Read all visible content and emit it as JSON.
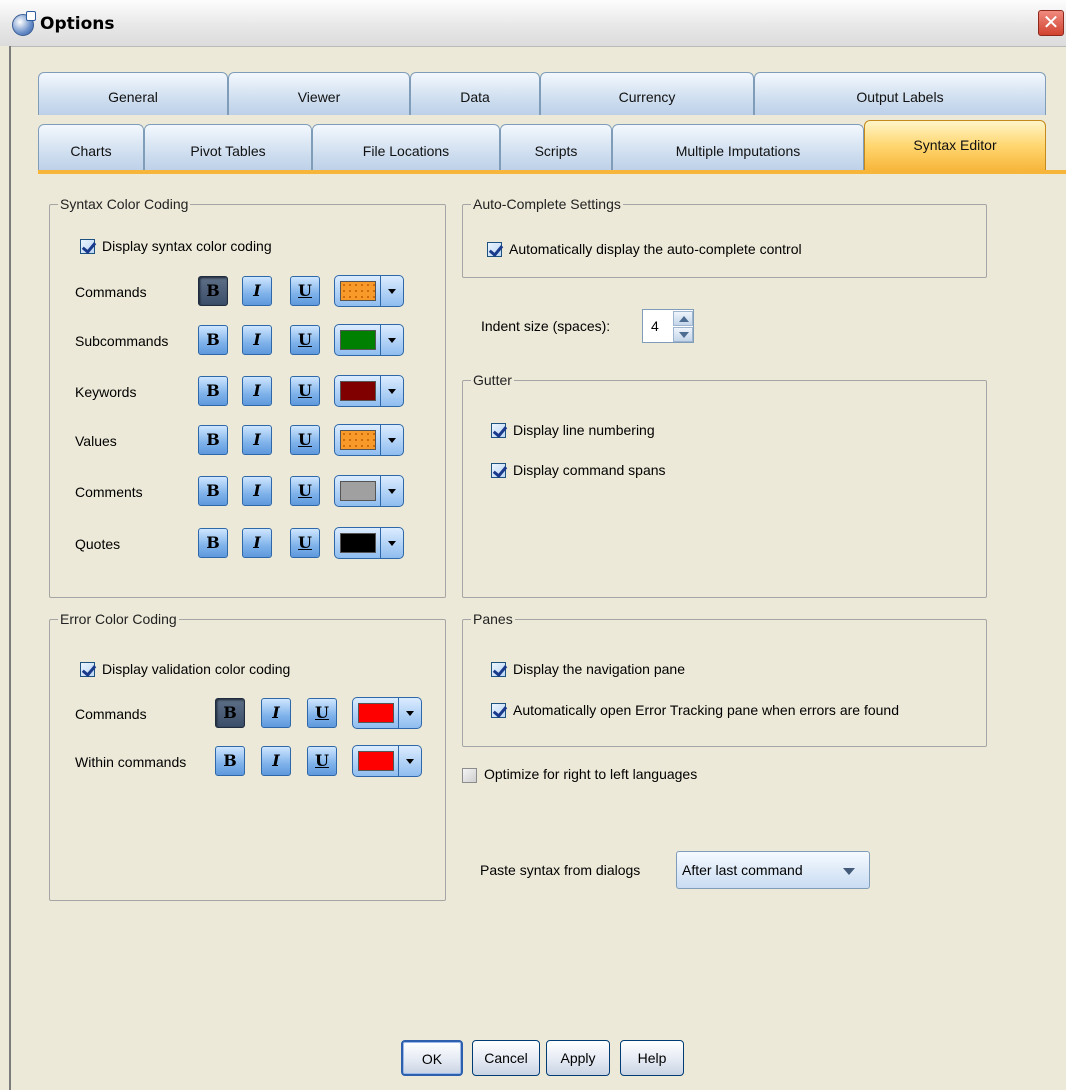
{
  "window": {
    "title": "Options",
    "close_glyph": "✕"
  },
  "tabs": {
    "row1": [
      "General",
      "Viewer",
      "Data",
      "Currency",
      "Output Labels"
    ],
    "row2": [
      "Charts",
      "Pivot Tables",
      "File Locations",
      "Scripts",
      "Multiple Imputations",
      "Syntax Editor"
    ],
    "active": "Syntax Editor"
  },
  "syntax_color_coding": {
    "legend": "Syntax Color Coding",
    "display_label": "Display syntax color coding",
    "display_checked": true,
    "rows": [
      {
        "label": "Commands",
        "bold": true,
        "italic": false,
        "underline": false,
        "color": "#f79a2a",
        "color_name": "orange"
      },
      {
        "label": "Subcommands",
        "bold": false,
        "italic": false,
        "underline": false,
        "color": "#008000",
        "color_name": "green"
      },
      {
        "label": "Keywords",
        "bold": false,
        "italic": false,
        "underline": false,
        "color": "#800000",
        "color_name": "maroon"
      },
      {
        "label": "Values",
        "bold": false,
        "italic": false,
        "underline": false,
        "color": "#f79a2a",
        "color_name": "orange"
      },
      {
        "label": "Comments",
        "bold": false,
        "italic": false,
        "underline": false,
        "color": "#a0a0a0",
        "color_name": "gray"
      },
      {
        "label": "Quotes",
        "bold": false,
        "italic": false,
        "underline": false,
        "color": "#000000",
        "color_name": "black"
      }
    ]
  },
  "error_color_coding": {
    "legend": "Error Color Coding",
    "display_label": "Display validation color coding",
    "display_checked": true,
    "rows": [
      {
        "label": "Commands",
        "bold": true,
        "italic": false,
        "underline": false,
        "color": "#ff0000",
        "color_name": "red"
      },
      {
        "label": "Within commands",
        "bold": false,
        "italic": false,
        "underline": false,
        "color": "#ff0000",
        "color_name": "red"
      }
    ]
  },
  "format_buttons": {
    "bold": "B",
    "italic": "I",
    "underline": "U"
  },
  "auto_complete": {
    "legend": "Auto-Complete Settings",
    "label": "Automatically display the auto-complete control",
    "checked": true
  },
  "indent": {
    "label": "Indent size (spaces):",
    "value": "4"
  },
  "gutter": {
    "legend": "Gutter",
    "items": [
      {
        "label": "Display line numbering",
        "checked": true
      },
      {
        "label": "Display command spans",
        "checked": true
      }
    ]
  },
  "panes": {
    "legend": "Panes",
    "items": [
      {
        "label": "Display the navigation pane",
        "checked": true
      },
      {
        "label": "Automatically open Error Tracking pane when errors are found",
        "checked": true
      }
    ]
  },
  "rtl": {
    "label": "Optimize for right to left languages",
    "checked": false
  },
  "paste": {
    "label": "Paste syntax from dialogs",
    "value": "After last command"
  },
  "buttons": {
    "ok": "OK",
    "cancel": "Cancel",
    "apply": "Apply",
    "help": "Help"
  }
}
